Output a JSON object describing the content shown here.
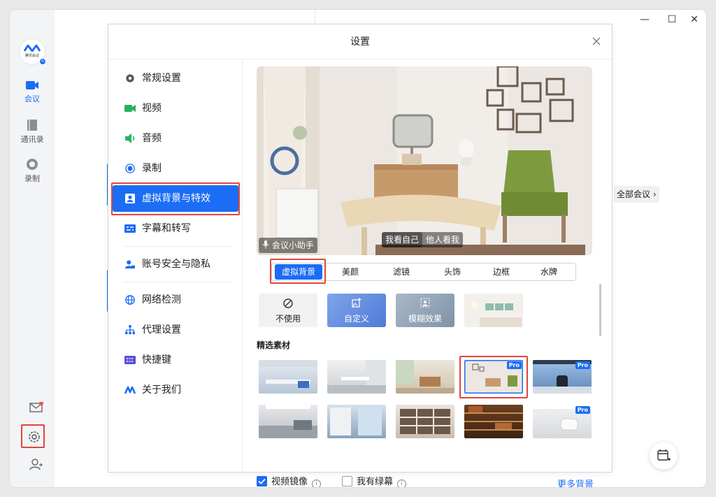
{
  "app": {
    "logo_text": "腾讯会议",
    "nav": [
      {
        "label": "会议",
        "icon": "video-camera-icon"
      },
      {
        "label": "通讯录",
        "icon": "address-book-icon"
      },
      {
        "label": "录制",
        "icon": "record-icon"
      }
    ],
    "see_all_meetings": "全部会议",
    "accent_color": "#1b6df5"
  },
  "dialog": {
    "title": "设置",
    "menu": [
      {
        "label": "常规设置",
        "icon": "gear-icon"
      },
      {
        "label": "视频",
        "icon": "camera-icon"
      },
      {
        "label": "音频",
        "icon": "speaker-icon"
      },
      {
        "label": "录制",
        "icon": "record-icon"
      },
      {
        "label": "虚拟背景与特效",
        "icon": "portrait-icon",
        "selected": true
      },
      {
        "label": "字幕和转写",
        "icon": "caption-icon"
      },
      {
        "label": "账号安全与隐私",
        "icon": "user-lock-icon"
      },
      {
        "label": "网络检测",
        "icon": "globe-icon"
      },
      {
        "label": "代理设置",
        "icon": "network-tree-icon"
      },
      {
        "label": "快捷键",
        "icon": "keyboard-icon"
      },
      {
        "label": "关于我们",
        "icon": "tencent-meeting-logo-icon"
      }
    ],
    "preview": {
      "assistant": "会议小助手",
      "view_self": "我看自己",
      "view_others": "他人看我"
    },
    "tabs": [
      "虚拟背景",
      "美颜",
      "滤镜",
      "头饰",
      "边框",
      "水牌"
    ],
    "tiles": [
      {
        "label": "不使用",
        "icon": "ban-icon"
      },
      {
        "label": "自定义",
        "icon": "add-image-icon"
      },
      {
        "label": "模糊效果",
        "icon": "blur-person-icon"
      }
    ],
    "section_title": "精选素材",
    "pro_badge": "Pro",
    "options": {
      "mirror": "视频镜像",
      "greenscreen": "我有绿幕",
      "more": "更多背景"
    }
  }
}
